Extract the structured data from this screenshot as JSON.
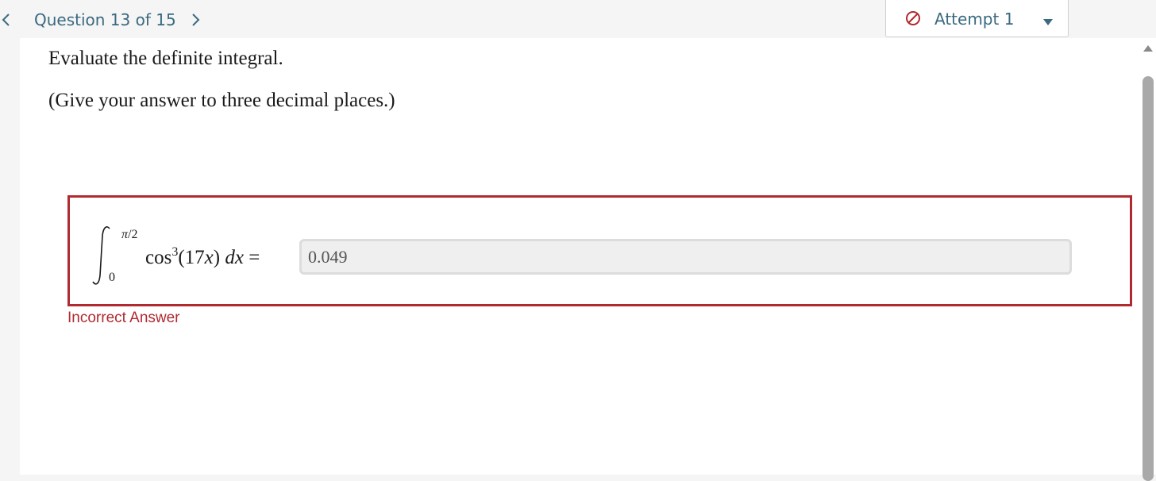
{
  "header": {
    "question_counter": "Question 13 of 15",
    "prev_icon": "chevron-left-icon",
    "next_icon": "chevron-right-icon",
    "attempt": {
      "label": "Attempt 1",
      "status_icon": "no-entry-icon",
      "dropdown_icon": "caret-down-icon",
      "status_color": "#b02a30"
    }
  },
  "question": {
    "instruction": "Evaluate the definite integral.",
    "note": "(Give your answer to three decimal places.)",
    "integral": {
      "upper_limit_symbol": "π",
      "upper_limit_rest": "/2",
      "lower_limit": "0",
      "func": "cos",
      "power": "3",
      "open_paren": "(17",
      "variable": "x",
      "close_paren": ")",
      "differential": "dx",
      "equals": "="
    },
    "answer_value": "0.049",
    "feedback": "Incorrect Answer"
  },
  "colors": {
    "accent": "#3a6a80",
    "error": "#b02a30",
    "background": "#f5f5f5"
  }
}
